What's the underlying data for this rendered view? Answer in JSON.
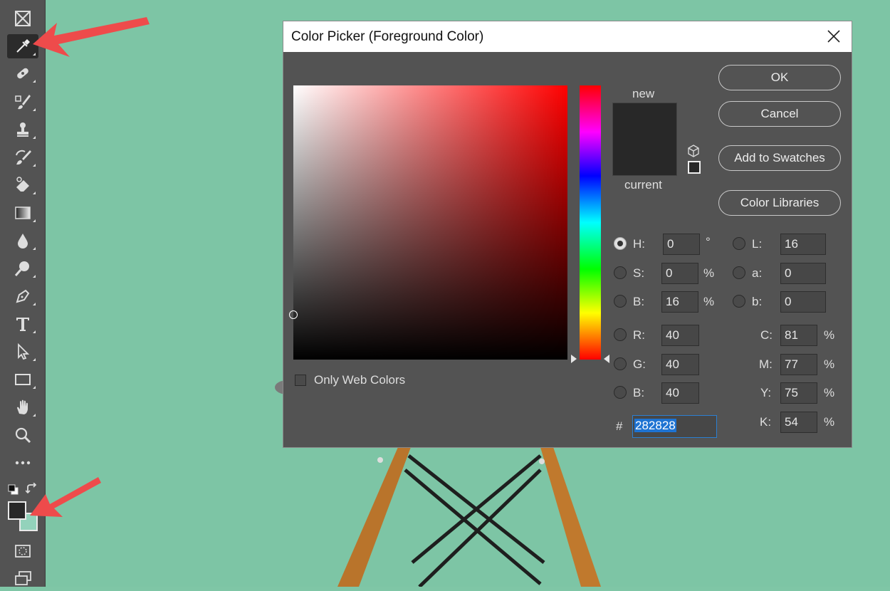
{
  "dialog": {
    "title": "Color Picker (Foreground Color)",
    "buttons": {
      "ok": "OK",
      "cancel": "Cancel",
      "add_swatches": "Add to Swatches",
      "libraries": "Color Libraries"
    },
    "preview": {
      "new_label": "new",
      "current_label": "current",
      "new_color": "#282828",
      "current_color": "#282828"
    },
    "only_web_label": "Only Web Colors",
    "hsb": {
      "h_label": "H:",
      "h_value": "0",
      "h_unit": "°",
      "s_label": "S:",
      "s_value": "0",
      "s_unit": "%",
      "b_label": "B:",
      "b_value": "16",
      "b_unit": "%"
    },
    "rgb": {
      "r_label": "R:",
      "r_value": "40",
      "g_label": "G:",
      "g_value": "40",
      "b_label": "B:",
      "b_value": "40"
    },
    "lab": {
      "l_label": "L:",
      "l_value": "16",
      "a_label": "a:",
      "a_value": "0",
      "b_label": "b:",
      "b_value": "0"
    },
    "cmyk": {
      "c_label": "C:",
      "c_value": "81",
      "m_label": "M:",
      "m_value": "77",
      "y_label": "Y:",
      "y_value": "75",
      "k_label": "K:",
      "k_value": "54",
      "unit": "%"
    },
    "hex_label": "#",
    "hex_value": "282828"
  },
  "toolbar": {
    "foreground_color": "#282828",
    "background_color": "#93d2bb",
    "tools": [
      "artboard-frame",
      "eyedropper",
      "healing-brush",
      "brush",
      "clone-stamp",
      "history-brush",
      "eraser",
      "gradient",
      "blur",
      "dodge",
      "pen",
      "type",
      "path-selection",
      "rectangle",
      "hand",
      "zoom",
      "more"
    ]
  },
  "colors": {
    "canvas": "#7dc5a5",
    "annotation_arrow": "#ee4b4b",
    "panel": "#535353"
  }
}
